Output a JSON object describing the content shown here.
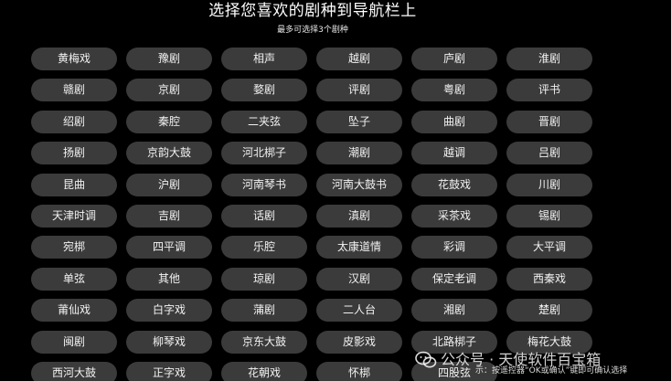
{
  "header": {
    "title": "选择您喜欢的剧种到导航栏上",
    "subtitle": "最多可选择3个剧种"
  },
  "options": [
    "黄梅戏",
    "豫剧",
    "相声",
    "越剧",
    "庐剧",
    "淮剧",
    "赣剧",
    "京剧",
    "婺剧",
    "评剧",
    "粤剧",
    "评书",
    "绍剧",
    "秦腔",
    "二夹弦",
    "坠子",
    "曲剧",
    "晋剧",
    "扬剧",
    "京韵大鼓",
    "河北梆子",
    "潮剧",
    "越调",
    "吕剧",
    "昆曲",
    "沪剧",
    "河南琴书",
    "河南大鼓书",
    "花鼓戏",
    "川剧",
    "天津时调",
    "吉剧",
    "话剧",
    "滇剧",
    "采茶戏",
    "锡剧",
    "宛梆",
    "四平调",
    "乐腔",
    "太康道情",
    "彩调",
    "大平调",
    "单弦",
    "其他",
    "琼剧",
    "汉剧",
    "保定老调",
    "西秦戏",
    "莆仙戏",
    "白字戏",
    "蒲剧",
    "二人台",
    "湘剧",
    "楚剧",
    "闽剧",
    "柳琴戏",
    "京东大鼓",
    "皮影戏",
    "北路梆子",
    "梅花大鼓",
    "西河大鼓",
    "正字戏",
    "花朝戏",
    "怀梆",
    "四股弦",
    ""
  ],
  "footer": {
    "hint": "示：按遥控器“OK或确认”键即可确认选择",
    "watermark": "公众号 · 天使软件百宝箱"
  },
  "colors": {
    "background": "#000000",
    "option_background": "#3b3b3b",
    "text": "#ffffff"
  }
}
